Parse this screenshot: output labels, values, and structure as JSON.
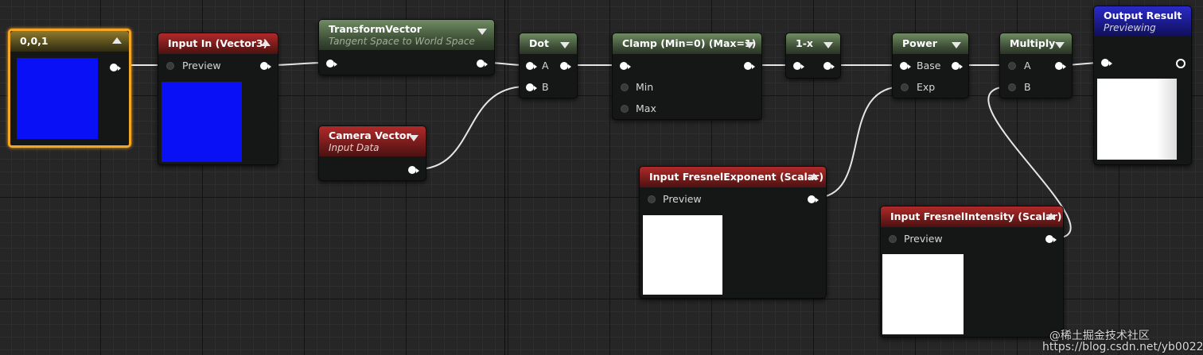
{
  "colors": {
    "constant_preview": "#0a10f5",
    "input_in_preview": "#0a10f5",
    "fresnel_exponent_preview": "#ffffff",
    "fresnel_intensity_preview": "#ffffff",
    "output_preview": "#ffffff",
    "selection": "#f5a623",
    "wire": "#e6e6e6"
  },
  "nodes": {
    "constant": {
      "title": "0,0,1"
    },
    "input_in": {
      "title": "Input In (Vector3)",
      "pin_preview": "Preview"
    },
    "transform_vector": {
      "title": "TransformVector",
      "subtitle": "Tangent Space to World Space"
    },
    "camera_vector": {
      "title": "Camera Vector",
      "subtitle": "Input Data"
    },
    "dot": {
      "title": "Dot",
      "pin_a": "A",
      "pin_b": "B"
    },
    "clamp": {
      "title": "Clamp (Min=0) (Max=1)",
      "pin_min": "Min",
      "pin_max": "Max"
    },
    "one_minus_x": {
      "title": "1-x"
    },
    "power": {
      "title": "Power",
      "pin_base": "Base",
      "pin_exp": "Exp"
    },
    "multiply": {
      "title": "Multiply",
      "pin_a": "A",
      "pin_b": "B"
    },
    "output_result": {
      "title": "Output Result",
      "subtitle": "Previewing"
    },
    "fresnel_exponent": {
      "title": "Input FresnelExponent (Scalar)",
      "pin_preview": "Preview"
    },
    "fresnel_intensity": {
      "title": "Input FresnelIntensity (Scalar)",
      "pin_preview": "Preview"
    }
  },
  "watermark": "@稀土掘金技术社区\nhttps://blog.csdn.net/yb0022"
}
